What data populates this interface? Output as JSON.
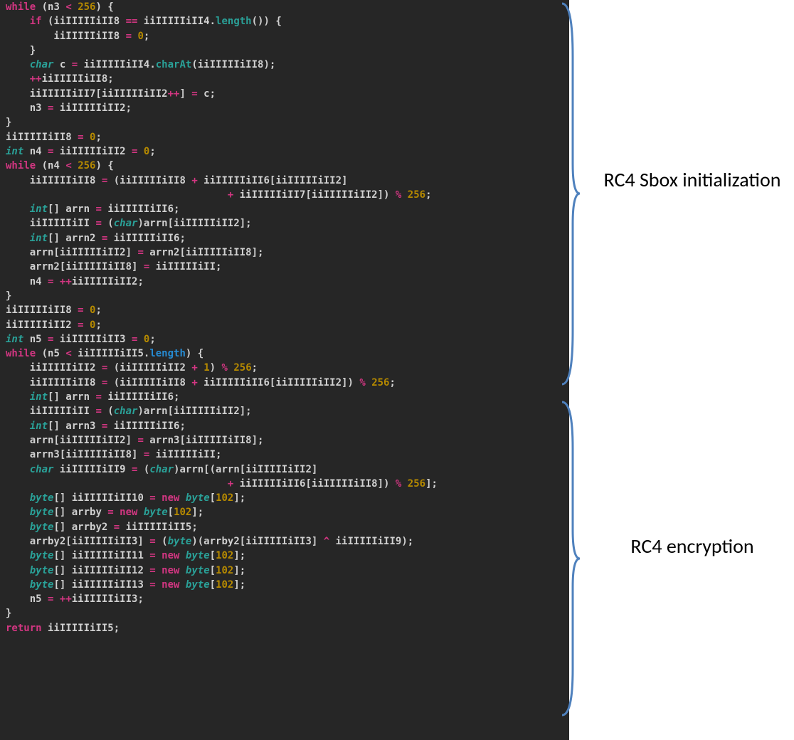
{
  "annotations": {
    "label1": "RC4 Sbox initialization",
    "label2": "RC4 encryption"
  },
  "code": {
    "lines": [
      [
        [
          "kw",
          "while"
        ],
        [
          "id",
          " (n3 "
        ],
        [
          "op",
          "<"
        ],
        [
          "id",
          " "
        ],
        [
          "num",
          "256"
        ],
        [
          "id",
          ") {"
        ]
      ],
      [
        [
          "id",
          "    "
        ],
        [
          "kw",
          "if"
        ],
        [
          "id",
          " (iiIIIIIiII8 "
        ],
        [
          "op",
          "=="
        ],
        [
          "id",
          " iiIIIIIiII4."
        ],
        [
          "call",
          "length"
        ],
        [
          "id",
          "()) {"
        ]
      ],
      [
        [
          "id",
          "        iiIIIIIiII8 "
        ],
        [
          "op",
          "="
        ],
        [
          "id",
          " "
        ],
        [
          "num",
          "0"
        ],
        [
          "id",
          ";"
        ]
      ],
      [
        [
          "id",
          "    }"
        ]
      ],
      [
        [
          "id",
          "    "
        ],
        [
          "type",
          "char"
        ],
        [
          "id",
          " c "
        ],
        [
          "op",
          "="
        ],
        [
          "id",
          " iiIIIIIiII4."
        ],
        [
          "call",
          "charAt"
        ],
        [
          "id",
          "(iiIIIIIiII8);"
        ]
      ],
      [
        [
          "id",
          "    "
        ],
        [
          "op",
          "++"
        ],
        [
          "id",
          "iiIIIIIiII8;"
        ]
      ],
      [
        [
          "id",
          "    iiIIIIIiII7[iiIIIIIiII2"
        ],
        [
          "op",
          "++"
        ],
        [
          "id",
          "] "
        ],
        [
          "op",
          "="
        ],
        [
          "id",
          " c;"
        ]
      ],
      [
        [
          "id",
          "    n3 "
        ],
        [
          "op",
          "="
        ],
        [
          "id",
          " iiIIIIIiII2;"
        ]
      ],
      [
        [
          "id",
          "}"
        ]
      ],
      [
        [
          "id",
          "iiIIIIIiII8 "
        ],
        [
          "op",
          "="
        ],
        [
          "id",
          " "
        ],
        [
          "num",
          "0"
        ],
        [
          "id",
          ";"
        ]
      ],
      [
        [
          "type",
          "int"
        ],
        [
          "id",
          " n4 "
        ],
        [
          "op",
          "="
        ],
        [
          "id",
          " iiIIIIIiII2 "
        ],
        [
          "op",
          "="
        ],
        [
          "id",
          " "
        ],
        [
          "num",
          "0"
        ],
        [
          "id",
          ";"
        ]
      ],
      [
        [
          "kw",
          "while"
        ],
        [
          "id",
          " (n4 "
        ],
        [
          "op",
          "<"
        ],
        [
          "id",
          " "
        ],
        [
          "num",
          "256"
        ],
        [
          "id",
          ") {"
        ]
      ],
      [
        [
          "id",
          "    iiIIIIIiII8 "
        ],
        [
          "op",
          "="
        ],
        [
          "id",
          " (iiIIIIIiII8 "
        ],
        [
          "op",
          "+"
        ],
        [
          "id",
          " iiIIIIIiII6[iiIIIIIiII2]"
        ]
      ],
      [
        [
          "id",
          "                                     "
        ],
        [
          "op",
          "+"
        ],
        [
          "id",
          " iiIIIIIiII7[iiIIIIIiII2]) "
        ],
        [
          "op",
          "%"
        ],
        [
          "id",
          " "
        ],
        [
          "num",
          "256"
        ],
        [
          "id",
          ";"
        ]
      ],
      [
        [
          "id",
          "    "
        ],
        [
          "type",
          "int"
        ],
        [
          "id",
          "[] arrn "
        ],
        [
          "op",
          "="
        ],
        [
          "id",
          " iiIIIIIiII6;"
        ]
      ],
      [
        [
          "id",
          "    iiIIIIIiII "
        ],
        [
          "op",
          "="
        ],
        [
          "id",
          " ("
        ],
        [
          "type",
          "char"
        ],
        [
          "id",
          ")arrn[iiIIIIIiII2];"
        ]
      ],
      [
        [
          "id",
          "    "
        ],
        [
          "type",
          "int"
        ],
        [
          "id",
          "[] arrn2 "
        ],
        [
          "op",
          "="
        ],
        [
          "id",
          " iiIIIIIiII6;"
        ]
      ],
      [
        [
          "id",
          "    arrn[iiIIIIIiII2] "
        ],
        [
          "op",
          "="
        ],
        [
          "id",
          " arrn2[iiIIIIIiII8];"
        ]
      ],
      [
        [
          "id",
          "    arrn2[iiIIIIIiII8] "
        ],
        [
          "op",
          "="
        ],
        [
          "id",
          " iiIIIIIiII;"
        ]
      ],
      [
        [
          "id",
          "    n4 "
        ],
        [
          "op",
          "="
        ],
        [
          "id",
          " "
        ],
        [
          "op",
          "++"
        ],
        [
          "id",
          "iiIIIIIiII2;"
        ]
      ],
      [
        [
          "id",
          "}"
        ]
      ],
      [
        [
          "id",
          "iiIIIIIiII8 "
        ],
        [
          "op",
          "="
        ],
        [
          "id",
          " "
        ],
        [
          "num",
          "0"
        ],
        [
          "id",
          ";"
        ]
      ],
      [
        [
          "id",
          "iiIIIIIiII2 "
        ],
        [
          "op",
          "="
        ],
        [
          "id",
          " "
        ],
        [
          "num",
          "0"
        ],
        [
          "id",
          ";"
        ]
      ],
      [
        [
          "type",
          "int"
        ],
        [
          "id",
          " n5 "
        ],
        [
          "op",
          "="
        ],
        [
          "id",
          " iiIIIIIiII3 "
        ],
        [
          "op",
          "="
        ],
        [
          "id",
          " "
        ],
        [
          "num",
          "0"
        ],
        [
          "id",
          ";"
        ]
      ],
      [
        [
          "kw",
          "while"
        ],
        [
          "id",
          " (n5 "
        ],
        [
          "op",
          "<"
        ],
        [
          "id",
          " iiIIIIIiII5."
        ],
        [
          "prop",
          "length"
        ],
        [
          "id",
          ") {"
        ]
      ],
      [
        [
          "id",
          "    iiIIIIIiII2 "
        ],
        [
          "op",
          "="
        ],
        [
          "id",
          " (iiIIIIIiII2 "
        ],
        [
          "op",
          "+"
        ],
        [
          "id",
          " "
        ],
        [
          "num",
          "1"
        ],
        [
          "id",
          ") "
        ],
        [
          "op",
          "%"
        ],
        [
          "id",
          " "
        ],
        [
          "num",
          "256"
        ],
        [
          "id",
          ";"
        ]
      ],
      [
        [
          "id",
          "    iiIIIIIiII8 "
        ],
        [
          "op",
          "="
        ],
        [
          "id",
          " (iiIIIIIiII8 "
        ],
        [
          "op",
          "+"
        ],
        [
          "id",
          " iiIIIIIiII6[iiIIIIIiII2]) "
        ],
        [
          "op",
          "%"
        ],
        [
          "id",
          " "
        ],
        [
          "num",
          "256"
        ],
        [
          "id",
          ";"
        ]
      ],
      [
        [
          "id",
          "    "
        ],
        [
          "type",
          "int"
        ],
        [
          "id",
          "[] arrn "
        ],
        [
          "op",
          "="
        ],
        [
          "id",
          " iiIIIIIiII6;"
        ]
      ],
      [
        [
          "id",
          "    iiIIIIIiII "
        ],
        [
          "op",
          "="
        ],
        [
          "id",
          " ("
        ],
        [
          "type",
          "char"
        ],
        [
          "id",
          ")arrn[iiIIIIIiII2];"
        ]
      ],
      [
        [
          "id",
          "    "
        ],
        [
          "type",
          "int"
        ],
        [
          "id",
          "[] arrn3 "
        ],
        [
          "op",
          "="
        ],
        [
          "id",
          " iiIIIIIiII6;"
        ]
      ],
      [
        [
          "id",
          "    arrn[iiIIIIIiII2] "
        ],
        [
          "op",
          "="
        ],
        [
          "id",
          " arrn3[iiIIIIIiII8];"
        ]
      ],
      [
        [
          "id",
          "    arrn3[iiIIIIIiII8] "
        ],
        [
          "op",
          "="
        ],
        [
          "id",
          " iiIIIIIiII;"
        ]
      ],
      [
        [
          "id",
          "    "
        ],
        [
          "type",
          "char"
        ],
        [
          "id",
          " iiIIIIIiII9 "
        ],
        [
          "op",
          "="
        ],
        [
          "id",
          " ("
        ],
        [
          "type",
          "char"
        ],
        [
          "id",
          ")arrn[(arrn[iiIIIIIiII2]"
        ]
      ],
      [
        [
          "id",
          "                                     "
        ],
        [
          "op",
          "+"
        ],
        [
          "id",
          " iiIIIIIiII6[iiIIIIIiII8]) "
        ],
        [
          "op",
          "%"
        ],
        [
          "id",
          " "
        ],
        [
          "num",
          "256"
        ],
        [
          "id",
          "];"
        ]
      ],
      [
        [
          "id",
          "    "
        ],
        [
          "type",
          "byte"
        ],
        [
          "id",
          "[] iiIIIIIiII10 "
        ],
        [
          "op",
          "="
        ],
        [
          "id",
          " "
        ],
        [
          "kw",
          "new"
        ],
        [
          "id",
          " "
        ],
        [
          "type",
          "byte"
        ],
        [
          "id",
          "["
        ],
        [
          "num",
          "102"
        ],
        [
          "id",
          "];"
        ]
      ],
      [
        [
          "id",
          "    "
        ],
        [
          "type",
          "byte"
        ],
        [
          "id",
          "[] arrby "
        ],
        [
          "op",
          "="
        ],
        [
          "id",
          " "
        ],
        [
          "kw",
          "new"
        ],
        [
          "id",
          " "
        ],
        [
          "type",
          "byte"
        ],
        [
          "id",
          "["
        ],
        [
          "num",
          "102"
        ],
        [
          "id",
          "];"
        ]
      ],
      [
        [
          "id",
          "    "
        ],
        [
          "type",
          "byte"
        ],
        [
          "id",
          "[] arrby2 "
        ],
        [
          "op",
          "="
        ],
        [
          "id",
          " iiIIIIIiII5;"
        ]
      ],
      [
        [
          "id",
          "    arrby2[iiIIIIIiII3] "
        ],
        [
          "op",
          "="
        ],
        [
          "id",
          " ("
        ],
        [
          "type",
          "byte"
        ],
        [
          "id",
          ")(arrby2[iiIIIIIiII3] "
        ],
        [
          "op",
          "^"
        ],
        [
          "id",
          " iiIIIIIiII9);"
        ]
      ],
      [
        [
          "id",
          "    "
        ],
        [
          "type",
          "byte"
        ],
        [
          "id",
          "[] iiIIIIIiII11 "
        ],
        [
          "op",
          "="
        ],
        [
          "id",
          " "
        ],
        [
          "kw",
          "new"
        ],
        [
          "id",
          " "
        ],
        [
          "type",
          "byte"
        ],
        [
          "id",
          "["
        ],
        [
          "num",
          "102"
        ],
        [
          "id",
          "];"
        ]
      ],
      [
        [
          "id",
          "    "
        ],
        [
          "type",
          "byte"
        ],
        [
          "id",
          "[] iiIIIIIiII12 "
        ],
        [
          "op",
          "="
        ],
        [
          "id",
          " "
        ],
        [
          "kw",
          "new"
        ],
        [
          "id",
          " "
        ],
        [
          "type",
          "byte"
        ],
        [
          "id",
          "["
        ],
        [
          "num",
          "102"
        ],
        [
          "id",
          "];"
        ]
      ],
      [
        [
          "id",
          "    "
        ],
        [
          "type",
          "byte"
        ],
        [
          "id",
          "[] iiIIIIIiII13 "
        ],
        [
          "op",
          "="
        ],
        [
          "id",
          " "
        ],
        [
          "kw",
          "new"
        ],
        [
          "id",
          " "
        ],
        [
          "type",
          "byte"
        ],
        [
          "id",
          "["
        ],
        [
          "num",
          "102"
        ],
        [
          "id",
          "];"
        ]
      ],
      [
        [
          "id",
          "    n5 "
        ],
        [
          "op",
          "="
        ],
        [
          "id",
          " "
        ],
        [
          "op",
          "++"
        ],
        [
          "id",
          "iiIIIIIiII3;"
        ]
      ],
      [
        [
          "id",
          "}"
        ]
      ],
      [
        [
          "kw",
          "return"
        ],
        [
          "id",
          " iiIIIIIiII5;"
        ]
      ]
    ]
  }
}
